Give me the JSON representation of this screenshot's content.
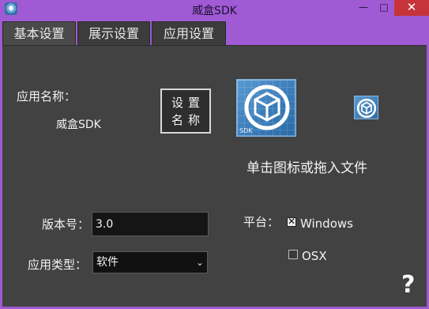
{
  "window": {
    "title": "威盒SDK"
  },
  "titlebar": {
    "minimize": "—",
    "maximize": "□",
    "close": "✕"
  },
  "tabs": [
    {
      "label": "基本设置"
    },
    {
      "label": "展示设置"
    },
    {
      "label": "应用设置"
    }
  ],
  "form": {
    "app_name_label": "应用名称：",
    "app_name_value": "威盒SDK",
    "set_name_button": "设置名称",
    "version_label": "版本号：",
    "version_value": "3.0",
    "app_type_label": "应用类型：",
    "app_type_selected": "软件",
    "platform_label": "平台：",
    "platforms": [
      {
        "label": "Windows",
        "checked": true
      },
      {
        "label": "OSX",
        "checked": false
      }
    ],
    "icon_hint": "单击图标或拖入文件",
    "icon_caption": "SDK"
  },
  "help": {
    "label": "?"
  },
  "colors": {
    "titlebar": "#9f5ad4",
    "panel": "#424242",
    "close": "#c7333a",
    "icon_blue": "#3b7dba"
  }
}
